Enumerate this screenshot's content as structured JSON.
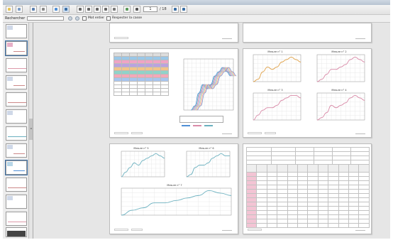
{
  "window": {
    "title": ""
  },
  "toolbar": {
    "page_input": "1",
    "page_count": "/ 18",
    "icons": [
      "folder-open-icon",
      "edit-icon",
      "save-icon",
      "zoom-icon",
      "grid-icon",
      "fit-page-icon",
      "first-page-icon",
      "prev-page-icon",
      "next-page-icon",
      "last-page-icon",
      "refresh-icon",
      "nav-first-icon",
      "nav-last-icon"
    ]
  },
  "search": {
    "label": "Rechercher",
    "placeholder": "",
    "option1": "Mot entier",
    "option2": "Respecter la casse"
  },
  "colors": {
    "accent": "#3a6ea5",
    "curve_teal": "#6ab0bf",
    "curve_pink": "#d98ba8",
    "curve_orange": "#e0a24a",
    "curve_blue": "#4f8fd6"
  },
  "pages": {
    "p2_chart": {
      "title": ""
    },
    "p3_charts": [
      {
        "title": "Mesure n° 1"
      },
      {
        "title": "Mesure n° 2"
      },
      {
        "title": "Mesure n° 3"
      },
      {
        "title": "Mesure n° 4"
      }
    ],
    "p4_charts": [
      {
        "title": "Mesure n° 5"
      },
      {
        "title": "Mesure n° 6"
      },
      {
        "title": "Mesure n° 7"
      }
    ]
  },
  "chart_data": [
    {
      "type": "line",
      "title": "Mesure n° 1",
      "x": [
        0,
        1,
        2,
        3,
        4,
        5,
        6,
        7,
        8,
        9,
        10
      ],
      "series": [
        {
          "values": [
            0,
            1,
            4,
            6,
            5,
            6,
            8,
            9,
            10,
            9,
            8
          ]
        }
      ]
    },
    {
      "type": "line",
      "title": "Mesure n° 2",
      "x": [
        0,
        1,
        2,
        3,
        4,
        5,
        6,
        7,
        8,
        9,
        10
      ],
      "series": [
        {
          "values": [
            0,
            1,
            3,
            5,
            5,
            6,
            7,
            9,
            10,
            9,
            8
          ]
        }
      ]
    },
    {
      "type": "line",
      "title": "Mesure n° 3",
      "x": [
        0,
        1,
        2,
        3,
        4,
        5,
        6,
        7,
        8,
        9,
        10
      ],
      "series": [
        {
          "values": [
            0,
            2,
            4,
            5,
            5,
            6,
            8,
            9,
            10,
            10,
            9
          ]
        }
      ]
    },
    {
      "type": "line",
      "title": "Mesure n° 4",
      "x": [
        0,
        1,
        2,
        3,
        4,
        5,
        6,
        7,
        8,
        9,
        10
      ],
      "series": [
        {
          "values": [
            0,
            1,
            3,
            6,
            5,
            6,
            7,
            9,
            10,
            9,
            8
          ]
        }
      ]
    },
    {
      "type": "line",
      "title": "Mesure n° 5",
      "x": [
        0,
        1,
        2,
        3,
        4,
        5,
        6,
        7,
        8,
        9,
        10
      ],
      "series": [
        {
          "values": [
            0,
            2,
            4,
            6,
            5,
            7,
            8,
            9,
            10,
            9,
            8
          ]
        }
      ]
    },
    {
      "type": "line",
      "title": "Mesure n° 6",
      "x": [
        0,
        1,
        2,
        3,
        4,
        5,
        6,
        7,
        8,
        9,
        10
      ],
      "series": [
        {
          "values": [
            0,
            1,
            4,
            5,
            5,
            6,
            8,
            9,
            10,
            9,
            9
          ]
        }
      ]
    },
    {
      "type": "line",
      "title": "Mesure n° 7",
      "x": [
        0,
        1,
        2,
        3,
        4,
        5,
        6,
        7,
        8,
        9,
        10
      ],
      "series": [
        {
          "values": [
            0,
            2,
            3,
            5,
            5,
            6,
            7,
            8,
            10,
            9,
            8
          ]
        }
      ]
    }
  ]
}
